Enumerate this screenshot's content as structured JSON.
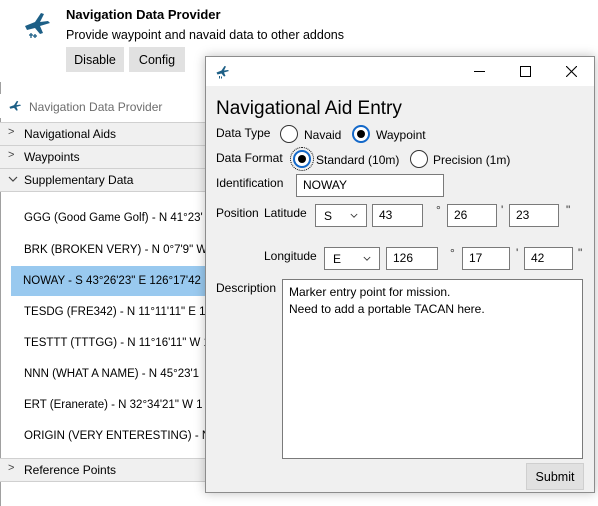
{
  "addon": {
    "title": "Navigation Data Provider",
    "description": "Provide waypoint and navaid data to other addons",
    "buttons": {
      "disable": "Disable",
      "config": "Config"
    }
  },
  "provider_window": {
    "title": "Navigation Data Provider",
    "sections": {
      "navaids": "Navigational Aids",
      "waypoints": "Waypoints",
      "supplementary": "Supplementary Data",
      "reference": "Reference Points"
    },
    "items": [
      "GGG (Good Game Golf) - N 41°23'",
      "BRK (BROKEN VERY) - N 0°7'9\" W",
      "NOWAY - S 43°26'23\" E 126°17'42",
      "TESDG (FRE342) - N 11°11'11\" E 1",
      "TESTTT (TTTGG) - N 11°16'11\" W 1",
      "NNN (WHAT A NAME) - N 45°23'1",
      "ERT (Eranerate) - N 32°34'21\" W 1",
      "ORIGIN (VERY ENTERESTING) - N 0"
    ],
    "selected_index": 2
  },
  "dialog": {
    "heading": "Navigational Aid Entry",
    "controls": {
      "minimize": "—",
      "maximize": "☐",
      "close": "✕"
    },
    "data_type": {
      "label": "Data Type",
      "options": [
        "Navaid",
        "Waypoint"
      ],
      "selected": "Waypoint"
    },
    "data_format": {
      "label": "Data Format",
      "options": [
        "Standard (10m)",
        "Precision (1m)"
      ],
      "selected": "Standard (10m)"
    },
    "identification": {
      "label": "Identification",
      "value": "NOWAY"
    },
    "position": {
      "label": "Position",
      "latitude": {
        "label": "Latitude",
        "hemisphere": "S",
        "deg": "43",
        "min": "26",
        "sec": "23"
      },
      "longitude": {
        "label": "Longitude",
        "hemisphere": "E",
        "deg": "126",
        "min": "17",
        "sec": "42"
      },
      "units": {
        "deg": "°",
        "min": "'",
        "sec": "\""
      }
    },
    "description": {
      "label": "Description",
      "value": "Marker entry point for mission.\nNeed to add a portable TACAN here."
    },
    "submit": "Submit"
  }
}
